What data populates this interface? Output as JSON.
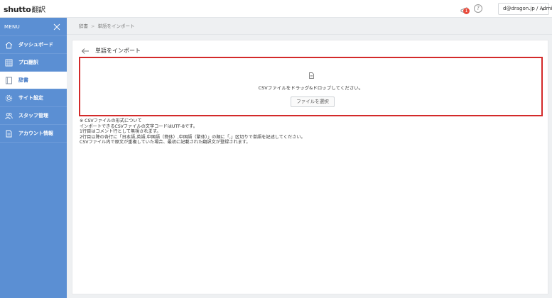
{
  "header": {
    "logo_brand": "shutto",
    "logo_suffix": "翻訳",
    "notification_count": "1",
    "help_label": "?",
    "user_label": "d@dragon.jp / Admin"
  },
  "sidebar": {
    "menu_label": "MENU",
    "items": [
      {
        "label": "ダッシュボード",
        "icon": "home-icon"
      },
      {
        "label": "プロ翻訳",
        "icon": "grid-icon"
      },
      {
        "label": "辞書",
        "icon": "book-icon"
      },
      {
        "label": "サイト設定",
        "icon": "gear-icon"
      },
      {
        "label": "スタッフ管理",
        "icon": "users-icon"
      },
      {
        "label": "アカウント情報",
        "icon": "document-icon"
      }
    ],
    "active_index": 2
  },
  "breadcrumb": {
    "parent": "辞書",
    "current": "単語をインポート"
  },
  "page": {
    "title": "単語をインポート",
    "dropzone_text": "CSVファイルをドラッグ&ドロップしてください。",
    "select_button": "ファイルを選択",
    "notes": [
      "※ CSVファイルの形式について",
      "インポートできるCSVファイルの文字コードはUTF-8です。",
      "1行目はコメント行として無視されます。",
      "2行目以降の各行に「日本語,英語,中国語（簡体）,中国語（繁体）」の順に「,」区切りで単語を記述してください。",
      "CSVファイル内で原文が重複していた場合、最初に記載された翻訳文が登録されます。"
    ]
  },
  "colors": {
    "sidebar": "#5b8fd3",
    "dropzone_border": "#d32a2a",
    "active_text": "#3e75c4"
  }
}
